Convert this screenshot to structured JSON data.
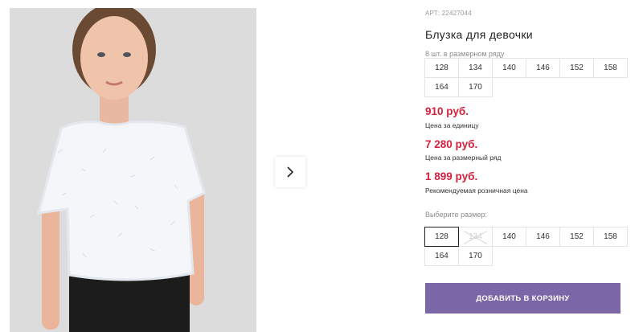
{
  "product": {
    "article": "АРТ: 22427044",
    "title": "Блузка для девочки"
  },
  "pack": {
    "label": "8 шт. в размерном ряду",
    "sizes": [
      "128",
      "134",
      "140",
      "146",
      "152",
      "158",
      "164",
      "170"
    ]
  },
  "prices": {
    "unit_price": "910 руб.",
    "unit_note": "Цена за единицу",
    "pack_price": "7 280 руб.",
    "pack_note": "Цена за размерный ряд",
    "retail_price": "1 899 руб.",
    "retail_note": "Рекомендуемая розничная цена",
    "accent_color": "#d4213d"
  },
  "size_select": {
    "label": "Выберите размер:",
    "options": [
      {
        "value": "128",
        "state": "selected"
      },
      {
        "value": "134",
        "state": "disabled"
      },
      {
        "value": "140",
        "state": "available"
      },
      {
        "value": "146",
        "state": "available"
      },
      {
        "value": "152",
        "state": "available"
      },
      {
        "value": "158",
        "state": "available"
      },
      {
        "value": "164",
        "state": "available"
      },
      {
        "value": "170",
        "state": "available"
      }
    ]
  },
  "cart": {
    "button_label": "ДОБАВИТЬ В КОРЗИНУ",
    "button_color": "#7b67a8"
  },
  "gallery": {
    "next_icon": "chevron-right-icon"
  }
}
